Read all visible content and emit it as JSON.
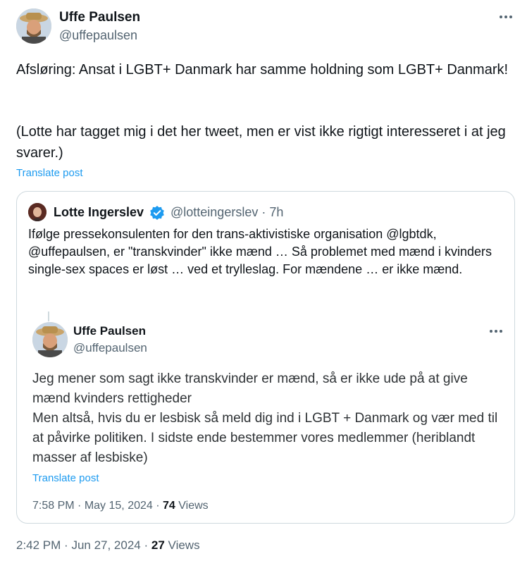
{
  "post": {
    "author_name": "Uffe Paulsen",
    "author_handle": "@uffepaulsen",
    "paragraph1": "Afsløring: Ansat i LGBT+ Danmark har samme holdning som LGBT+ Danmark!",
    "paragraph2": "(Lotte har tagget mig i det her tweet, men er vist ikke rigtigt interesseret i at jeg svarer.)",
    "translate_label": "Translate post",
    "time": "2:42 PM",
    "date": "Jun 27, 2024",
    "views_count": "27",
    "views_label": "Views",
    "more_icon": "more-dots-icon"
  },
  "quote": {
    "author_name": "Lotte Ingerslev",
    "author_handle": "@lotteingerslev",
    "age": "7h",
    "verified_icon": "verified-badge-icon",
    "text": "Ifølge pressekonsulenten for den trans-aktivistiske organisation @lgbtdk, @uffepaulsen, er \"transkvinder\" ikke mænd … Så problemet med mænd i kvinders single-sex spaces er løst … ved et trylleslag. For mændene … er ikke mænd.",
    "inner": {
      "author_name": "Uffe Paulsen",
      "author_handle": "@uffepaulsen",
      "line1": "Jeg mener som sagt ikke transkvinder er mænd, så er ikke ude på at give mænd kvinders rettigheder",
      "line2": "Men altså, hvis du er lesbisk så meld dig ind i LGBT + Danmark og vær med til at påvirke politiken. I sidste ende bestemmer vores medlemmer (heriblandt masser af lesbiske)",
      "translate_label": "Translate post",
      "time": "7:58 PM",
      "date": "May 15, 2024",
      "views_count": "74",
      "views_label": "Views"
    }
  },
  "colors": {
    "link": "#1d9bf0",
    "secondary_text": "#536471",
    "border": "#cfd9de"
  }
}
